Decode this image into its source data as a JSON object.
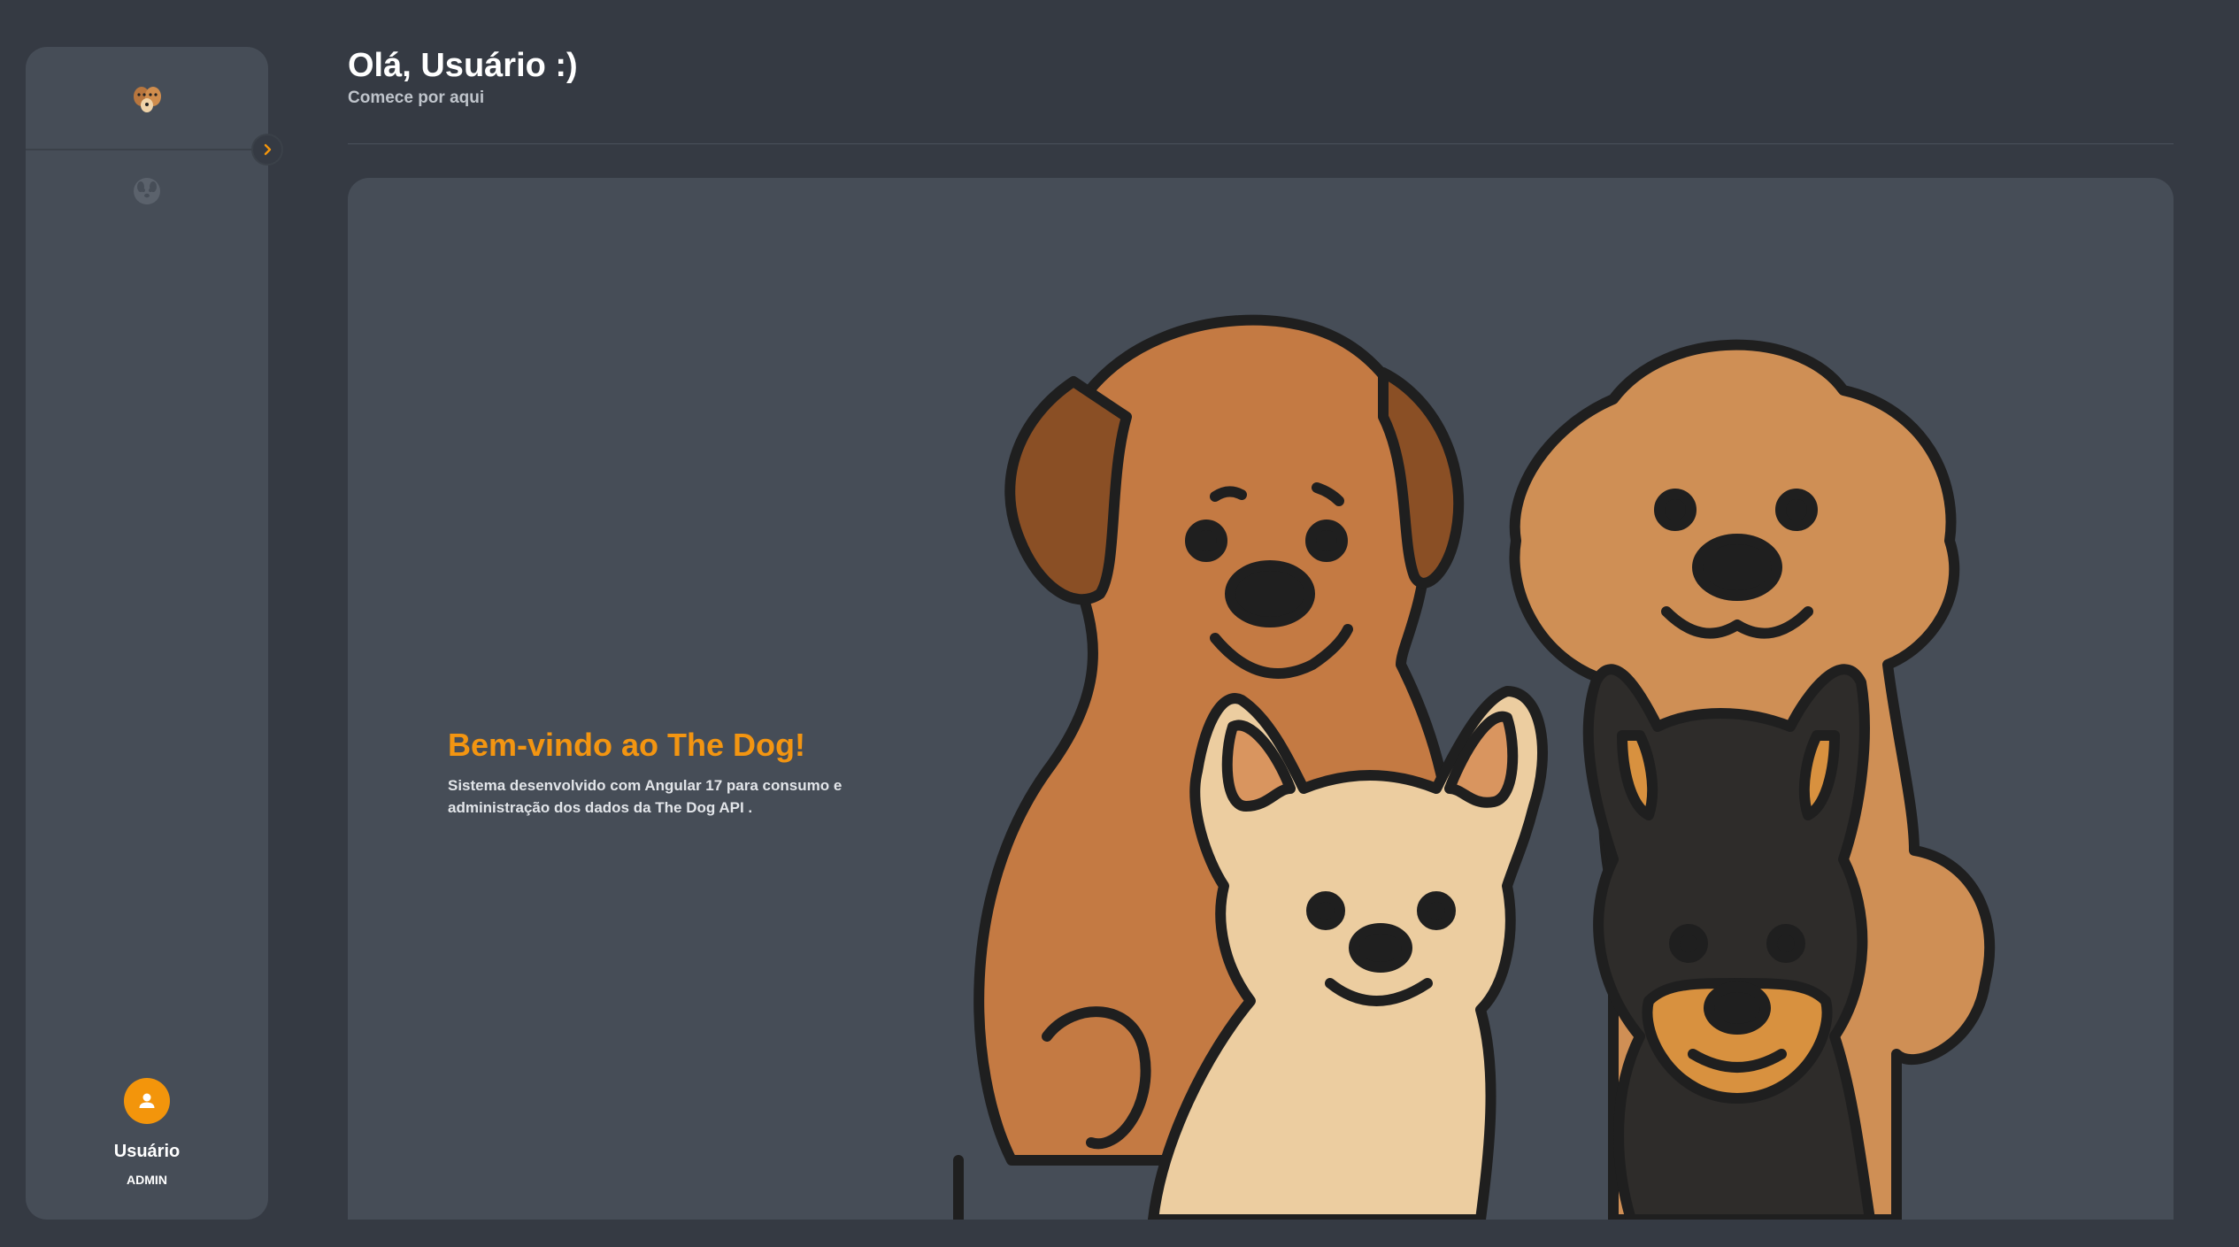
{
  "header": {
    "title": "Olá, Usuário :)",
    "subtitle": "Comece por aqui"
  },
  "sidebar": {
    "logo_icon": "dogs-logo-icon",
    "toggle_icon": "chevron-right-icon",
    "items": [
      {
        "icon": "dog-face-icon"
      }
    ],
    "user": {
      "avatar_icon": "person-icon",
      "name": "Usuário",
      "role": "ADMIN"
    }
  },
  "main": {
    "welcome_title": "Bem-vindo ao The Dog!",
    "welcome_text": "Sistema desenvolvido com Angular 17 para consumo e administração dos dados da The Dog API ."
  },
  "colors": {
    "background": "#353a43",
    "panel": "#464d57",
    "accent": "#f3950b"
  }
}
